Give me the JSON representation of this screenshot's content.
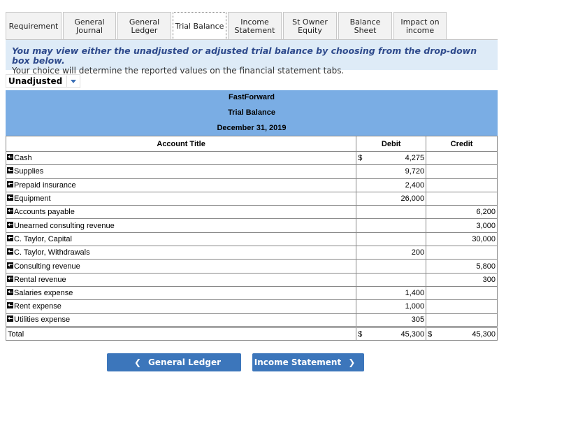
{
  "tabs": [
    {
      "label": "Requirement",
      "lines": [
        "Requirement"
      ],
      "active": false
    },
    {
      "label": "General Journal",
      "lines": [
        "General",
        "Journal"
      ],
      "active": false
    },
    {
      "label": "General Ledger",
      "lines": [
        "General",
        "Ledger"
      ],
      "active": false
    },
    {
      "label": "Trial Balance",
      "lines": [
        "Trial Balance"
      ],
      "active": true
    },
    {
      "label": "Income Statement",
      "lines": [
        "Income",
        "Statement"
      ],
      "active": false
    },
    {
      "label": "St Owner Equity",
      "lines": [
        "St Owner",
        "Equity"
      ],
      "active": false
    },
    {
      "label": "Balance Sheet",
      "lines": [
        "Balance",
        "Sheet"
      ],
      "active": false
    },
    {
      "label": "Impact on income",
      "lines": [
        "Impact on",
        "income"
      ],
      "active": false
    }
  ],
  "info": {
    "line1": "You may view either the unadjusted or adjusted trial balance by choosing from the drop-down box below.",
    "line2": "Your choice will determine the reported values on the financial statement tabs."
  },
  "dropdown": {
    "selected": "Unadjusted"
  },
  "statement": {
    "company": "FastForward",
    "title": "Trial Balance",
    "date": "December 31, 2019"
  },
  "table": {
    "headers": {
      "account": "Account Title",
      "debit": "Debit",
      "credit": "Credit"
    },
    "rows": [
      {
        "account": "Cash",
        "debit_cur": "$",
        "debit": "4,275",
        "credit_cur": "",
        "credit": ""
      },
      {
        "account": "Supplies",
        "debit_cur": "",
        "debit": "9,720",
        "credit_cur": "",
        "credit": ""
      },
      {
        "account": "Prepaid insurance",
        "debit_cur": "",
        "debit": "2,400",
        "credit_cur": "",
        "credit": ""
      },
      {
        "account": "Equipment",
        "debit_cur": "",
        "debit": "26,000",
        "credit_cur": "",
        "credit": ""
      },
      {
        "account": "Accounts payable",
        "debit_cur": "",
        "debit": "",
        "credit_cur": "",
        "credit": "6,200"
      },
      {
        "account": "Unearned consulting revenue",
        "debit_cur": "",
        "debit": "",
        "credit_cur": "",
        "credit": "3,000"
      },
      {
        "account": "C. Taylor, Capital",
        "debit_cur": "",
        "debit": "",
        "credit_cur": "",
        "credit": "30,000"
      },
      {
        "account": "C. Taylor, Withdrawals",
        "debit_cur": "",
        "debit": "200",
        "credit_cur": "",
        "credit": ""
      },
      {
        "account": "Consulting revenue",
        "debit_cur": "",
        "debit": "",
        "credit_cur": "",
        "credit": "5,800"
      },
      {
        "account": "Rental revenue",
        "debit_cur": "",
        "debit": "",
        "credit_cur": "",
        "credit": "300"
      },
      {
        "account": "Salaries expense",
        "debit_cur": "",
        "debit": "1,400",
        "credit_cur": "",
        "credit": ""
      },
      {
        "account": "Rent expense",
        "debit_cur": "",
        "debit": "1,000",
        "credit_cur": "",
        "credit": ""
      },
      {
        "account": "Utilities expense",
        "debit_cur": "",
        "debit": "305",
        "credit_cur": "",
        "credit": ""
      }
    ],
    "total": {
      "label": "Total",
      "debit_cur": "$",
      "debit": "45,300",
      "credit_cur": "$",
      "credit": "45,300"
    }
  },
  "nav": {
    "prev_label": "General Ledger",
    "prev_icon": "chevron-left-icon",
    "next_label": "Income Statement",
    "next_icon": "chevron-right-icon"
  }
}
